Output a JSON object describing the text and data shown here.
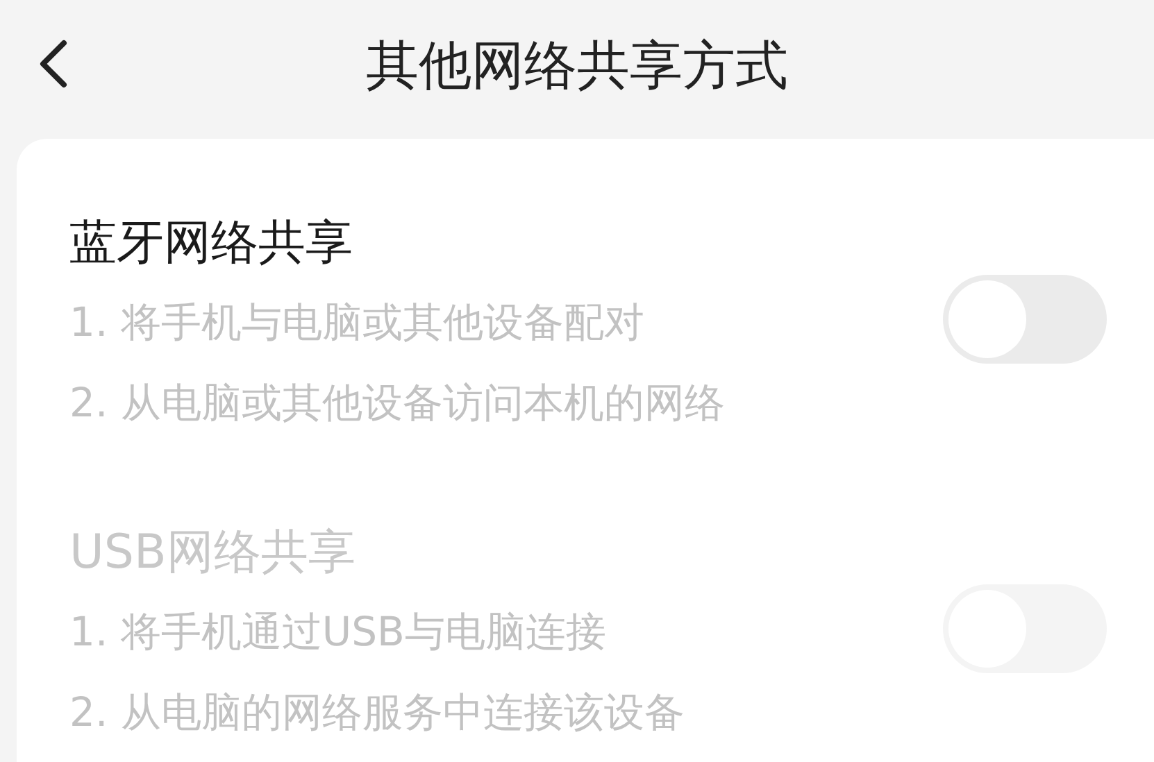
{
  "header": {
    "title": "其他网络共享方式"
  },
  "sections": [
    {
      "title": "蓝牙网络共享",
      "disabled": false,
      "steps": [
        "1. 将手机与电脑或其他设备配对",
        "2. 从电脑或其他设备访问本机的网络"
      ],
      "toggle": {
        "on": false
      }
    },
    {
      "title": "USB网络共享",
      "disabled": true,
      "steps": [
        "1. 将手机通过USB与电脑连接",
        "2. 从电脑的网络服务中连接该设备"
      ],
      "toggle": {
        "on": false
      }
    }
  ]
}
